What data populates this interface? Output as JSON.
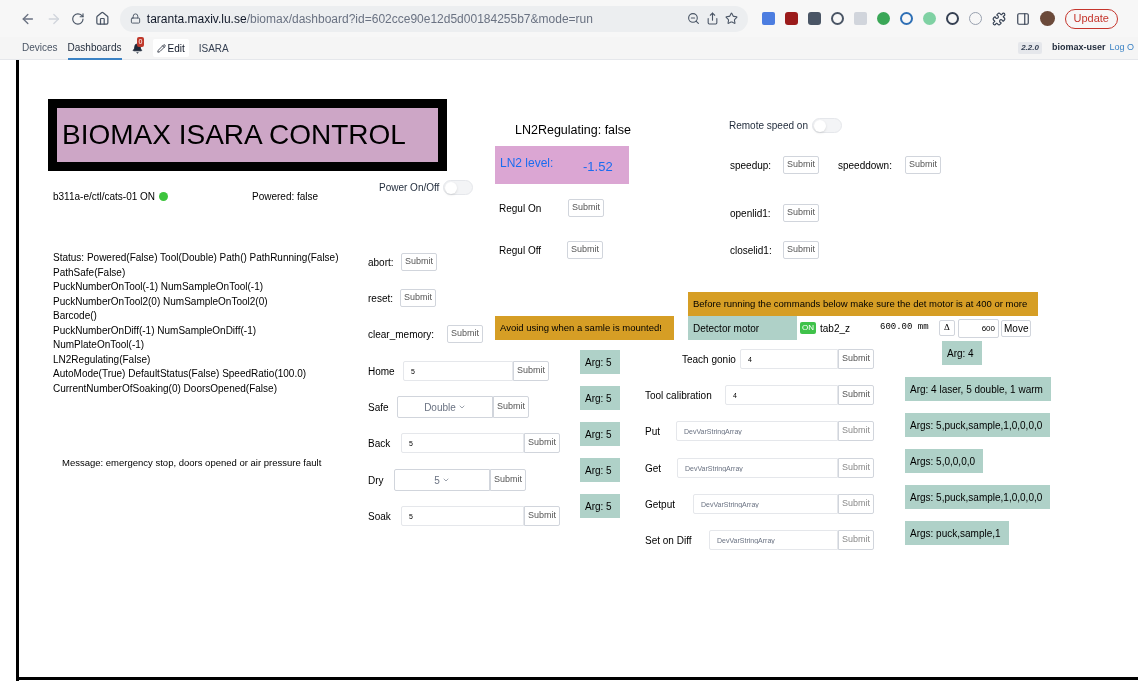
{
  "browser": {
    "url_host": "taranta.maxiv.lu.se",
    "url_path": "/biomax/dashboard?id=602cce90e12d5d00184255b7&mode=run",
    "update_button": "Update"
  },
  "nav": {
    "tabs": [
      {
        "label": "Devices",
        "selected": false
      },
      {
        "label": "Dashboards",
        "selected": true
      }
    ],
    "notification_count": "0",
    "edit_button": "Edit",
    "dashboard_name": "ISARA",
    "version": "2.2.0",
    "user": "biomax-user",
    "logout": "Log O"
  },
  "title": "BIOMAX ISARA CONTROL",
  "device": {
    "name": "b311a-e/ctl/cats-01 ON",
    "on": true
  },
  "powered": "Powered: false",
  "switches": [
    {
      "label": "Power On/Off",
      "on": false
    },
    {
      "label": "Remote speed on",
      "on": false
    }
  ],
  "status_lines": [
    "Status: Powered(False) Tool(Double) Path() PathRunning(False)",
    "PathSafe(False)",
    "PuckNumberOnTool(-1) NumSampleOnTool(-1)",
    "PuckNumberOnTool2(0) NumSampleOnTool2(0)",
    "Barcode()",
    "PuckNumberOnDiff(-1) NumSampleOnDiff(-1)",
    "NumPlateOnTool(-1)",
    "LN2Regulating(False)",
    "AutoMode(True) DefaultStatus(False) SpeedRatio(100.0)",
    "CurrentNumberOfSoaking(0) DoorsOpened(False)"
  ],
  "message": "Message: emergency stop, doors opened or air pressure fault",
  "ln2_regulating": "LN2Regulating: false",
  "ln2_level": {
    "label": "LN2 level:",
    "value": "-1.52"
  },
  "commands": [
    {
      "label": "abort:",
      "button": "Submit"
    },
    {
      "label": "reset:",
      "button": "Submit"
    },
    {
      "label": "clear_memory:",
      "button": "Submit"
    },
    {
      "label": "Regul On",
      "button": "Submit"
    },
    {
      "label": "Regul Off",
      "button": "Submit"
    },
    {
      "label": "speedup:",
      "button": "Submit"
    },
    {
      "label": "speeddown:",
      "button": "Submit"
    },
    {
      "label": "openlid1:",
      "button": "Submit"
    },
    {
      "label": "closelid1:",
      "button": "Submit"
    }
  ],
  "notes": [
    "Avoid using when a samle is mounted!",
    "Before running the commands below make sure the det motor is at 400 or more"
  ],
  "motor": {
    "label": "Detector motor",
    "state": "ON",
    "name": "tab2_z",
    "position": "600.00 mm",
    "delta": "Δ",
    "value": "600",
    "button": "Move"
  },
  "input_commands": [
    {
      "label": "Home",
      "kind": "input",
      "value": "5",
      "button": "Submit",
      "disabled": false
    },
    {
      "label": "Safe",
      "kind": "select",
      "value": "Double",
      "button": "Submit",
      "disabled": false
    },
    {
      "label": "Back",
      "kind": "input",
      "value": "5",
      "button": "Submit",
      "disabled": false
    },
    {
      "label": "Dry",
      "kind": "select",
      "value": "5",
      "button": "Submit",
      "disabled": false
    },
    {
      "label": "Soak",
      "kind": "input",
      "value": "5",
      "button": "Submit",
      "disabled": false
    },
    {
      "label": "Teach gonio",
      "kind": "input",
      "value": "4",
      "button": "Submit",
      "disabled": false
    },
    {
      "label": "Tool calibration",
      "kind": "input",
      "value": "4",
      "button": "Submit",
      "disabled": false
    },
    {
      "label": "Put",
      "kind": "input",
      "placeholder": "DevVarStringArray",
      "button": "Submit",
      "disabled": true
    },
    {
      "label": "Get",
      "kind": "input",
      "placeholder": "DevVarStringArray",
      "button": "Submit",
      "disabled": true
    },
    {
      "label": "Getput",
      "kind": "input",
      "placeholder": "DevVarStringArray",
      "button": "Submit",
      "disabled": true
    },
    {
      "label": "Set on Diff",
      "kind": "input",
      "placeholder": "DevVarStringArray",
      "button": "Submit",
      "disabled": true
    }
  ],
  "arg_labels": [
    "Arg: 5",
    "Arg: 5",
    "Arg: 5",
    "Arg: 5",
    "Arg: 5",
    "Arg: 4",
    "Arg: 4 laser, 5 double, 1 warm",
    "Args: 5,puck,sample,1,0,0,0,0",
    "Args: 5,0,0,0,0",
    "Args: 5,puck,sample,1,0,0,0,0",
    "Args: puck,sample,1"
  ]
}
